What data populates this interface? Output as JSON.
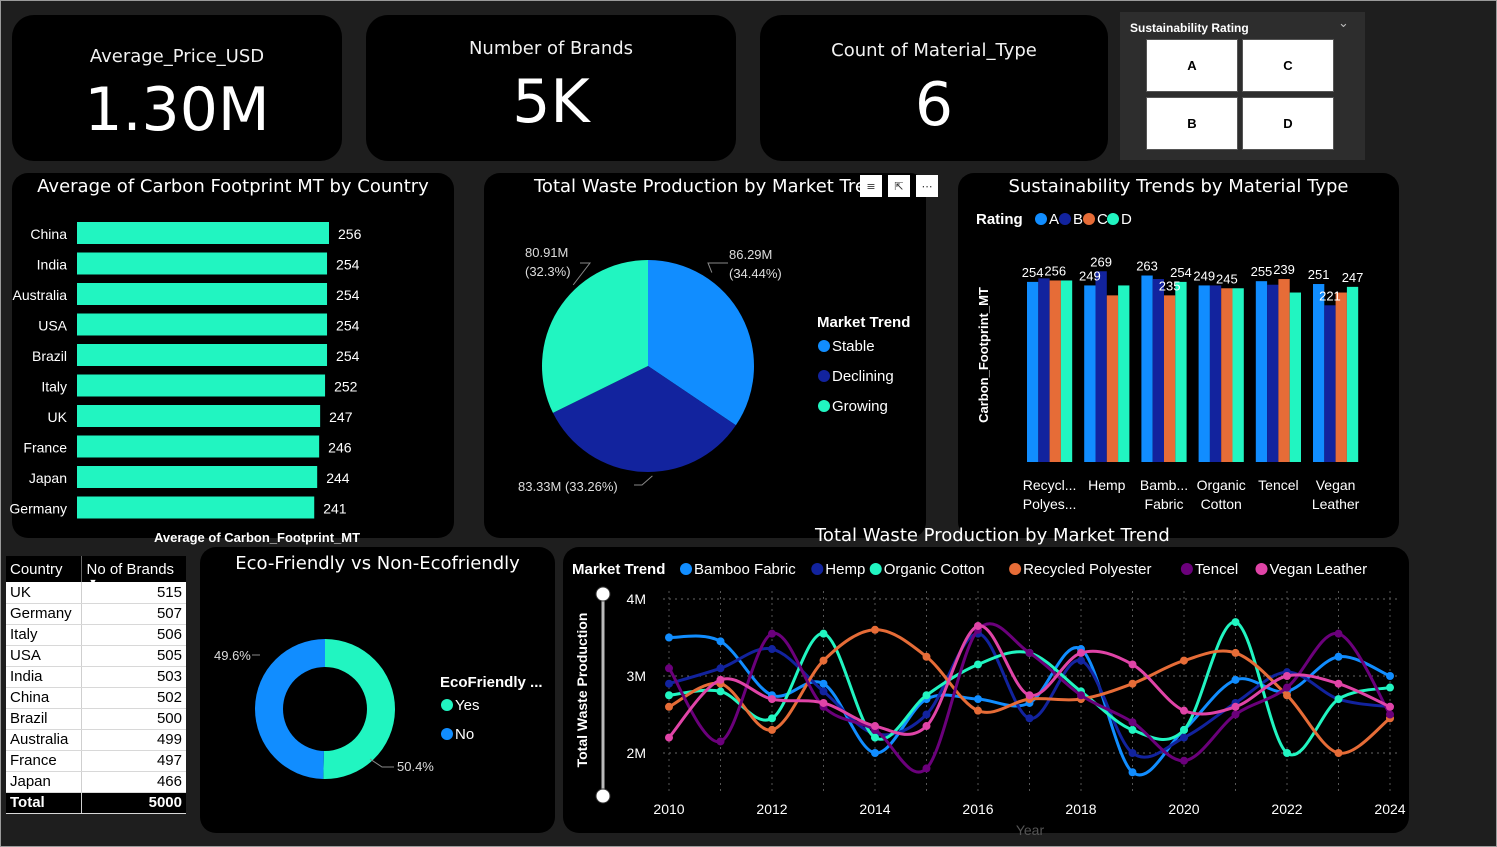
{
  "kpis": [
    {
      "title": "Average_Price_USD",
      "value": "1.30M"
    },
    {
      "title": "Number of Brands",
      "value": "5K"
    },
    {
      "title": "Count of Material_Type",
      "value": "6"
    }
  ],
  "slicer": {
    "title": "Sustainability Rating",
    "options": [
      "A",
      "C",
      "B",
      "D"
    ],
    "chevron_icon": "chevron-down-icon"
  },
  "country_bar": {
    "title": "Average of Carbon Footprint MT by Country",
    "xlabel": "Average of Carbon_Footprint_MT",
    "color": "#21f5c1"
  },
  "pie": {
    "title": "Total Waste Production by Market Tre",
    "legend_title": "Market Trend",
    "labels": [
      "86.29M",
      "(34.44%)",
      "83.33M (33.26%)",
      "80.91M",
      "(32.3%)"
    ],
    "header_icons": [
      "filter-icon",
      "focus-mode-icon",
      "more-options-icon"
    ]
  },
  "material_chart": {
    "title": "Sustainability Trends by Material Type",
    "legend_title": "Rating",
    "ylabel": "Carbon_Footprint_MT",
    "category_labels": [
      [
        "Recycl...",
        "Polyes..."
      ],
      [
        "Hemp"
      ],
      [
        "Bamb...",
        "Fabric"
      ],
      [
        "Organic",
        "Cotton"
      ],
      [
        "Tencel"
      ],
      [
        "Vegan",
        "Leather"
      ]
    ]
  },
  "table": {
    "headers": [
      "Country",
      "No of Brands"
    ],
    "rows": [
      [
        "UK",
        "515"
      ],
      [
        "Germany",
        "507"
      ],
      [
        "Italy",
        "506"
      ],
      [
        "USA",
        "505"
      ],
      [
        "India",
        "503"
      ],
      [
        "China",
        "502"
      ],
      [
        "Brazil",
        "500"
      ],
      [
        "Australia",
        "499"
      ],
      [
        "France",
        "497"
      ],
      [
        "Japan",
        "466"
      ]
    ],
    "total": [
      "Total",
      "5000"
    ]
  },
  "donut": {
    "title": "Eco-Friendly vs Non-Ecofriendly",
    "legend_title": "EcoFriendly ...",
    "labels": [
      "49.6%",
      "50.4%"
    ]
  },
  "line_chart": {
    "title": "Total Waste Production by Market Trend",
    "legend_title": "Market Trend",
    "ylabel": "Total Waste Production",
    "xlabel": "Year",
    "ytick_labels": [
      "4M",
      "3M",
      "2M"
    ],
    "xtick_labels": [
      "2010",
      "2012",
      "2014",
      "2016",
      "2018",
      "2020",
      "2022",
      "2024"
    ]
  },
  "chart_data": [
    {
      "type": "bar",
      "orientation": "horizontal",
      "title": "Average of Carbon Footprint MT by Country",
      "xlabel": "Average of Carbon_Footprint_MT",
      "categories": [
        "China",
        "India",
        "Australia",
        "USA",
        "Brazil",
        "Italy",
        "UK",
        "France",
        "Japan",
        "Germany"
      ],
      "values": [
        256,
        254,
        254,
        254,
        254,
        252,
        247,
        246,
        244,
        241
      ],
      "data_labels": [
        "256",
        "254",
        "254",
        "254",
        "254",
        "252",
        "247",
        "246",
        "244",
        "241"
      ],
      "xlim": [
        0,
        256
      ],
      "grid": false
    },
    {
      "type": "pie",
      "title": "Total Waste Production by Market Tre",
      "legend_title": "Market Trend",
      "categories": [
        "Stable",
        "Declining",
        "Growing"
      ],
      "values": [
        86.29,
        83.33,
        80.91
      ],
      "percent": [
        34.44,
        33.26,
        32.3
      ],
      "unit": "M",
      "colors": [
        "#118dff",
        "#12239e",
        "#21f5c1"
      ],
      "legend_position": "right"
    },
    {
      "type": "bar",
      "title": "Sustainability Trends by Material Type",
      "ylabel": "Carbon_Footprint_MT",
      "legend_title": "Rating",
      "legend_position": "top-left",
      "categories": [
        "Recycled Polyester",
        "Hemp",
        "Bamboo Fabric",
        "Organic Cotton",
        "Tencel",
        "Vegan Leather"
      ],
      "series": [
        {
          "name": "A",
          "color": "#118dff",
          "values": [
            254,
            249,
            263,
            249,
            255,
            251
          ]
        },
        {
          "name": "B",
          "color": "#12239e",
          "values": [
            259,
            269,
            258,
            249,
            250,
            221
          ]
        },
        {
          "name": "C",
          "color": "#e66c37",
          "values": [
            256,
            235,
            235,
            245,
            258,
            239
          ]
        },
        {
          "name": "D",
          "color": "#21f5c1",
          "values": [
            256,
            249,
            254,
            245,
            239,
            247
          ]
        }
      ],
      "data_labels": [
        {
          "category": "Recycled Polyester",
          "series": "A",
          "text": "254"
        },
        {
          "category": "Recycled Polyester",
          "series": "C",
          "text": "256"
        },
        {
          "category": "Hemp",
          "series": "A",
          "text": "249"
        },
        {
          "category": "Hemp",
          "series": "B",
          "text": "269"
        },
        {
          "category": "Bamboo Fabric",
          "series": "A",
          "text": "263"
        },
        {
          "category": "Bamboo Fabric",
          "series": "C",
          "text": "235"
        },
        {
          "category": "Bamboo Fabric",
          "series": "D",
          "text": "254"
        },
        {
          "category": "Organic Cotton",
          "series": "A",
          "text": "249"
        },
        {
          "category": "Organic Cotton",
          "series": "C",
          "text": "245"
        },
        {
          "category": "Tencel",
          "series": "A",
          "text": "255"
        },
        {
          "category": "Tencel",
          "series": "C",
          "text": "239"
        },
        {
          "category": "Vegan Leather",
          "series": "A",
          "text": "251"
        },
        {
          "category": "Vegan Leather",
          "series": "B",
          "text": "221"
        },
        {
          "category": "Vegan Leather",
          "series": "D",
          "text": "247"
        }
      ],
      "ylim": [
        0,
        275
      ]
    },
    {
      "type": "pie",
      "subtype": "donut",
      "title": "Eco-Friendly vs Non-Ecofriendly",
      "legend_title": "EcoFriendly ...",
      "categories": [
        "Yes",
        "No"
      ],
      "values": [
        50.4,
        49.6
      ],
      "unit": "%",
      "colors": [
        "#21f5c1",
        "#118dff"
      ],
      "legend_position": "right"
    },
    {
      "type": "line",
      "title": "Total Waste Production by Market Trend",
      "xlabel": "Year",
      "ylabel": "Total Waste Production",
      "legend_title": "Market Trend",
      "legend_position": "top",
      "smooth": true,
      "grid": true,
      "x": [
        2010,
        2011,
        2012,
        2013,
        2014,
        2015,
        2016,
        2017,
        2018,
        2019,
        2020,
        2021,
        2022,
        2023,
        2024
      ],
      "ylim": [
        1.7,
        4.0
      ],
      "unit": "M",
      "series": [
        {
          "name": "Bamboo Fabric",
          "color": "#118dff",
          "values": [
            3.5,
            3.45,
            2.75,
            2.9,
            2.0,
            2.7,
            2.7,
            2.65,
            3.35,
            1.75,
            2.3,
            2.95,
            2.8,
            3.25,
            3.0
          ]
        },
        {
          "name": "Hemp",
          "color": "#12239e",
          "values": [
            2.9,
            3.1,
            3.35,
            2.8,
            2.25,
            2.5,
            3.55,
            2.45,
            3.2,
            2.0,
            2.2,
            2.65,
            3.05,
            2.7,
            2.6
          ]
        },
        {
          "name": "Organic Cotton",
          "color": "#21f5c1",
          "values": [
            2.75,
            2.8,
            2.45,
            3.55,
            2.2,
            2.75,
            3.15,
            3.3,
            2.8,
            2.3,
            2.3,
            3.7,
            2.0,
            2.7,
            2.85
          ]
        },
        {
          "name": "Recycled Polyester",
          "color": "#e66c37",
          "values": [
            2.6,
            2.9,
            2.3,
            3.2,
            3.6,
            3.25,
            2.55,
            2.7,
            2.7,
            2.9,
            3.2,
            3.3,
            2.75,
            2.0,
            2.45
          ]
        },
        {
          "name": "Tencel",
          "color": "#6b007b",
          "values": [
            3.1,
            2.15,
            3.55,
            2.6,
            2.3,
            1.8,
            3.6,
            3.3,
            2.75,
            2.4,
            1.9,
            2.5,
            2.85,
            3.55,
            2.5
          ]
        },
        {
          "name": "Vegan Leather",
          "color": "#e044a7",
          "values": [
            2.2,
            2.95,
            2.7,
            2.65,
            2.35,
            2.35,
            3.65,
            2.75,
            3.3,
            3.15,
            2.55,
            2.6,
            3.0,
            2.9,
            2.6
          ]
        }
      ]
    }
  ]
}
